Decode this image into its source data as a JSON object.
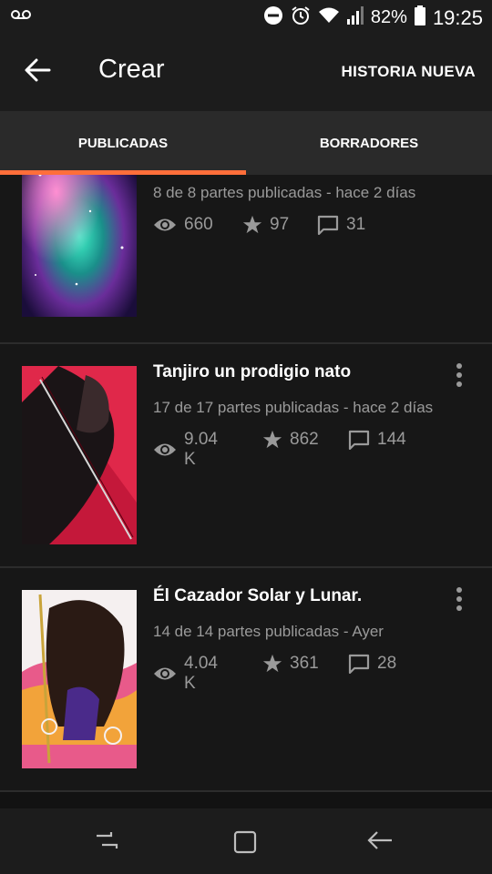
{
  "status_bar": {
    "time": "19:25",
    "battery": "82%",
    "icons": [
      "voicemail-icon",
      "do-not-disturb-icon",
      "alarm-icon",
      "wifi-icon",
      "signal-icon",
      "battery-icon"
    ]
  },
  "app_bar": {
    "title": "Crear",
    "action": "HISTORIA NUEVA"
  },
  "tabs": [
    {
      "label": "PUBLICADAS",
      "active": true
    },
    {
      "label": "BORRADORES",
      "active": false
    }
  ],
  "colors": {
    "accent": "#ff6e3a",
    "background": "#121212",
    "text_secondary": "#9a9a9a"
  },
  "stories": [
    {
      "title": "",
      "meta": "8 de 8 partes publicadas - hace 2 días",
      "reads": "660",
      "votes": "97",
      "comments": "31"
    },
    {
      "title": "Tanjiro un prodigio nato",
      "meta": "17 de 17 partes publicadas - hace 2 días",
      "reads": "9.04 K",
      "votes": "862",
      "comments": "144"
    },
    {
      "title": "Él Cazador Solar y Lunar.",
      "meta": "14 de 14 partes publicadas - Ayer",
      "reads": "4.04 K",
      "votes": "361",
      "comments": "28"
    }
  ]
}
